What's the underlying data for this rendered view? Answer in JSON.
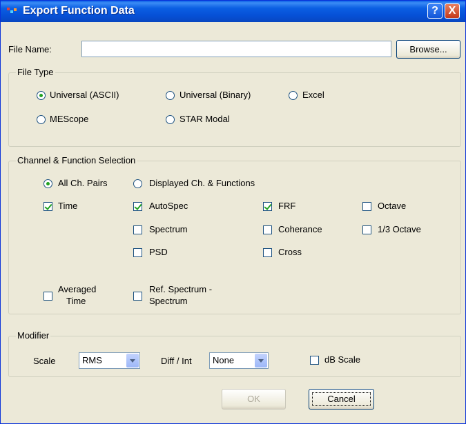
{
  "window": {
    "title": "Export Function Data",
    "help_label": "?",
    "close_label": "X"
  },
  "file": {
    "name_label": "File Name:",
    "name_value": "",
    "browse_label": "Browse..."
  },
  "file_type": {
    "legend": "File Type",
    "options": [
      "Universal (ASCII)",
      "Universal (Binary)",
      "Excel",
      "MEScope",
      "STAR Modal"
    ],
    "selected": "Universal (ASCII)"
  },
  "selection": {
    "legend": "Channel & Function Selection",
    "radio_options": [
      "All Ch. Pairs",
      "Displayed Ch. & Functions"
    ],
    "radio_selected": "All Ch. Pairs",
    "checks": {
      "time": {
        "label": "Time",
        "checked": true
      },
      "autospec": {
        "label": "AutoSpec",
        "checked": true
      },
      "frf": {
        "label": "FRF",
        "checked": true
      },
      "octave": {
        "label": "Octave",
        "checked": false
      },
      "spectrum": {
        "label": "Spectrum",
        "checked": false
      },
      "coherance": {
        "label": "Coherance",
        "checked": false
      },
      "third_octave": {
        "label": "1/3 Octave",
        "checked": false
      },
      "psd": {
        "label": "PSD",
        "checked": false
      },
      "cross": {
        "label": "Cross",
        "checked": false
      },
      "averaged_time": {
        "label_line1": "Averaged",
        "label_line2": "Time",
        "checked": false
      },
      "ref_spectrum": {
        "label_line1": "Ref. Spectrum -",
        "label_line2": "Spectrum",
        "checked": false
      }
    }
  },
  "modifier": {
    "legend": "Modifier",
    "scale_label": "Scale",
    "scale_value": "RMS",
    "diff_label": "Diff / Int",
    "diff_value": "None",
    "db_label": "dB Scale",
    "db_checked": false
  },
  "buttons": {
    "ok_label": "OK",
    "cancel_label": "Cancel"
  },
  "colors": {
    "title_bar": "#0650d6",
    "dialog_bg": "#ece9d8",
    "check_mark": "#21a121",
    "close_button": "#c4391a"
  }
}
